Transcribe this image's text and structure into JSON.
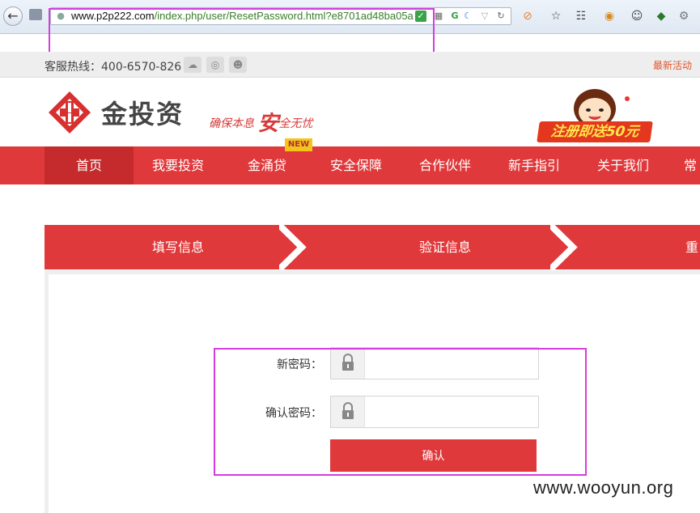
{
  "browser": {
    "url_host": "www.p2p222.com",
    "url_path": "/index.php/user/ResetPassword.html?e8701ad48ba05a"
  },
  "info_strip": {
    "hotline": "客服热线：400-6570-826",
    "latest_activity": "最新活动"
  },
  "header": {
    "logo_text": "金投资",
    "slogan_pre": "确保本息",
    "slogan_big": "安",
    "slogan_post": "全无忧",
    "promo_text": "注册即送50元"
  },
  "nav": {
    "items": [
      {
        "label": "首页"
      },
      {
        "label": "我要投资"
      },
      {
        "label": "金涌贷"
      },
      {
        "label": "安全保障"
      },
      {
        "label": "合作伙伴"
      },
      {
        "label": "新手指引"
      },
      {
        "label": "关于我们"
      },
      {
        "label": "常"
      }
    ],
    "badge": "NEW"
  },
  "steps": [
    {
      "label": "填写信息"
    },
    {
      "label": "验证信息"
    },
    {
      "label": "重"
    }
  ],
  "form": {
    "new_password_label": "新密码：",
    "confirm_password_label": "确认密码：",
    "new_password_value": "",
    "confirm_password_value": "",
    "submit_label": "确认"
  },
  "watermark": "www.wooyun.org",
  "colors": {
    "brand_red": "#e0393b",
    "annotation": "#d83be0"
  }
}
